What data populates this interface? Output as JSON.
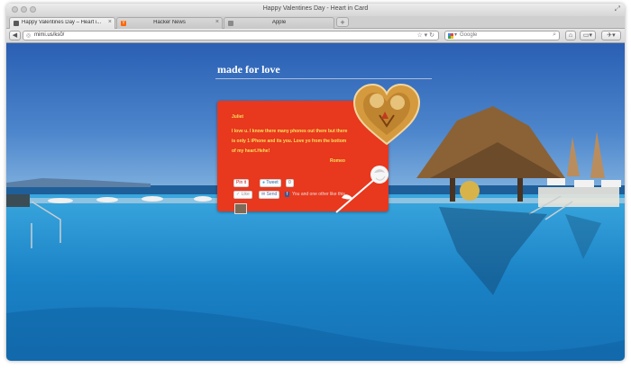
{
  "window": {
    "title": "Happy Valentines Day - Heart in Card"
  },
  "tabs": [
    {
      "label": "Happy Valentines Day – Heart i...",
      "close": "×",
      "favicon": "page-icon",
      "color": "#555555"
    },
    {
      "label": "Hacker News",
      "close": "×",
      "favicon": "y-icon",
      "color": "#ff6600"
    },
    {
      "label": "Apple",
      "close": "×",
      "favicon": "apple-icon",
      "color": "#777777"
    }
  ],
  "new_tab_label": "+",
  "navbar": {
    "url": "mimi.us/ks0/",
    "search_placeholder": "Google",
    "back": "◀",
    "forward": "▶"
  },
  "page": {
    "heading": "made for love",
    "card": {
      "to": "Juliet",
      "message": "I love u. I know there many phones out there but there is only 1 iPhone and its you. Love yo from the bottom of my heart.Hehe!",
      "from": "Romeo",
      "pin_label": "Pin it",
      "tweet_label": "Tweet",
      "tweet_count": "0",
      "like_label": "Like",
      "send_label": "Send",
      "fb_text": "You and one other like this",
      "fb_glyph": "f"
    }
  },
  "colors": {
    "card": "#e8381e",
    "card_text": "#f7e05a",
    "sky": "#2e64b4",
    "pool": "#1a84c8"
  }
}
